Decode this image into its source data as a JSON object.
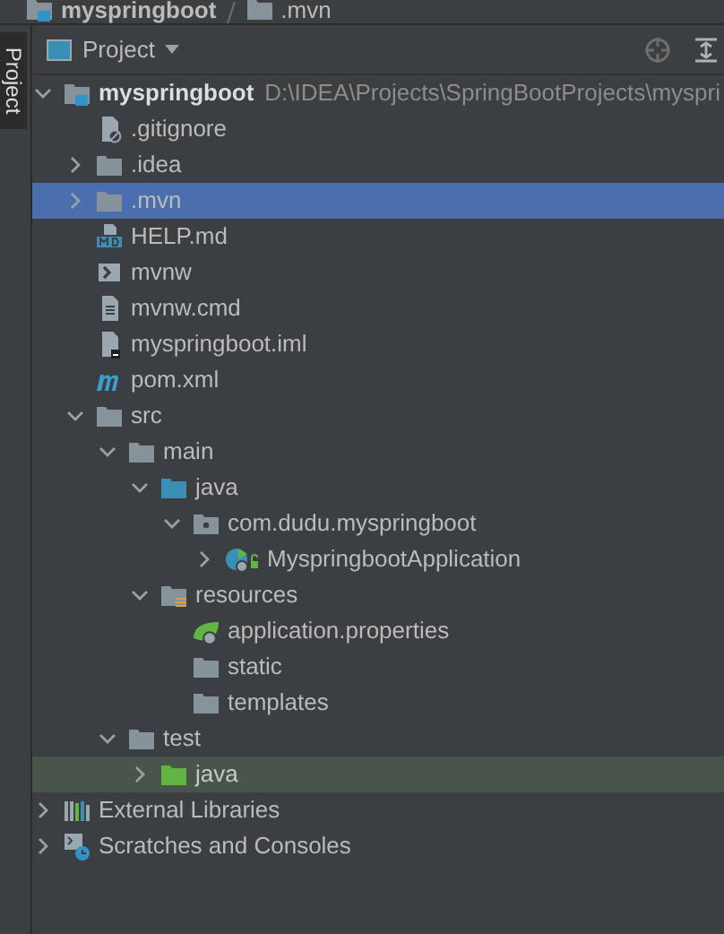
{
  "breadcrumb": [
    {
      "label": "myspringboot",
      "kind": "module"
    },
    {
      "label": ".mvn",
      "kind": "folder"
    }
  ],
  "side_tab": {
    "label": "Project"
  },
  "panel": {
    "title": "Project"
  },
  "tree": [
    {
      "label": "myspringboot",
      "path": "D:\\IDEA\\Projects\\SpringBootProjects\\myspri",
      "kind": "module",
      "expanded": true,
      "selected": false,
      "highlighted": false,
      "children": [
        {
          "label": ".gitignore",
          "kind": "ignore",
          "selected": false,
          "highlighted": false
        },
        {
          "label": ".idea",
          "kind": "folder",
          "expanded": false,
          "selected": false,
          "highlighted": false
        },
        {
          "label": ".mvn",
          "kind": "folder",
          "expanded": false,
          "selected": true,
          "highlighted": false
        },
        {
          "label": "HELP.md",
          "kind": "markdown",
          "selected": false,
          "highlighted": false
        },
        {
          "label": "mvnw",
          "kind": "script",
          "selected": false,
          "highlighted": false
        },
        {
          "label": "mvnw.cmd",
          "kind": "text",
          "selected": false,
          "highlighted": false
        },
        {
          "label": "myspringboot.iml",
          "kind": "iml",
          "selected": false,
          "highlighted": false
        },
        {
          "label": "pom.xml",
          "kind": "maven",
          "selected": false,
          "highlighted": false
        },
        {
          "label": "src",
          "kind": "folder",
          "expanded": true,
          "selected": false,
          "highlighted": false,
          "children": [
            {
              "label": "main",
              "kind": "folder",
              "expanded": true,
              "selected": false,
              "highlighted": false,
              "children": [
                {
                  "label": "java",
                  "kind": "source",
                  "expanded": true,
                  "selected": false,
                  "highlighted": false,
                  "children": [
                    {
                      "label": "com.dudu.myspringboot",
                      "kind": "package",
                      "expanded": true,
                      "selected": false,
                      "highlighted": false,
                      "children": [
                        {
                          "label": "MyspringbootApplication",
                          "kind": "spring-class",
                          "expanded": false,
                          "selected": false,
                          "highlighted": false
                        }
                      ]
                    }
                  ]
                },
                {
                  "label": "resources",
                  "kind": "resources",
                  "expanded": true,
                  "selected": false,
                  "highlighted": false,
                  "children": [
                    {
                      "label": "application.properties",
                      "kind": "spring-properties",
                      "selected": false,
                      "highlighted": false
                    },
                    {
                      "label": "static",
                      "kind": "folder",
                      "selected": false,
                      "highlighted": false
                    },
                    {
                      "label": "templates",
                      "kind": "folder",
                      "selected": false,
                      "highlighted": false
                    }
                  ]
                }
              ]
            },
            {
              "label": "test",
              "kind": "folder",
              "expanded": true,
              "selected": false,
              "highlighted": false,
              "children": [
                {
                  "label": "java",
                  "kind": "test-source",
                  "expanded": false,
                  "selected": false,
                  "highlighted": true
                }
              ]
            }
          ]
        }
      ]
    },
    {
      "label": "External Libraries",
      "kind": "libraries",
      "expanded": false,
      "selected": false,
      "highlighted": false
    },
    {
      "label": "Scratches and Consoles",
      "kind": "scratches",
      "expanded": false,
      "selected": false,
      "highlighted": false
    }
  ]
}
